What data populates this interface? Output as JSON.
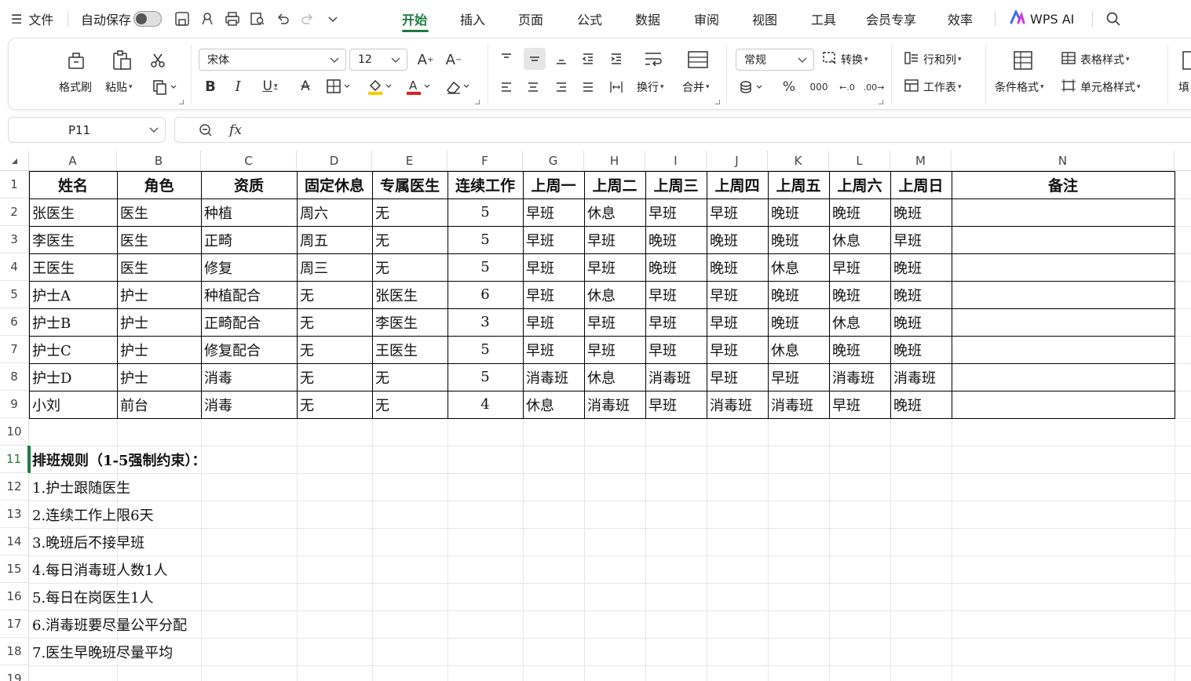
{
  "menubar": {
    "file_label": "文件",
    "autosave_label": "自动保存",
    "tabs": [
      "开始",
      "插入",
      "页面",
      "公式",
      "数据",
      "审阅",
      "视图",
      "工具",
      "会员专享",
      "效率"
    ],
    "wps_ai_label": "WPS AI",
    "colors": {
      "active_tab": "#1f7a41"
    }
  },
  "ribbon": {
    "format_painter": "格式刷",
    "paste": "粘贴",
    "font_name": "宋体",
    "font_size": "12",
    "wrap": "换行",
    "merge": "合并",
    "number_format": "常规",
    "convert": "转换",
    "row_col": "行和列",
    "worksheet": "工作表",
    "cond_format": "条件格式",
    "table_style": "表格样式",
    "cell_style": "单元格样式",
    "fill": "填",
    "font_color": "#e02020",
    "highlight_color": "#f5d000"
  },
  "formula_bar": {
    "cell_ref": "P11",
    "fx": "fx",
    "value": ""
  },
  "sheet": {
    "columns": [
      "A",
      "B",
      "C",
      "D",
      "E",
      "F",
      "G",
      "H",
      "I",
      "J",
      "K",
      "L",
      "M",
      "N"
    ],
    "rows": [
      "1",
      "2",
      "3",
      "4",
      "5",
      "6",
      "7",
      "8",
      "9",
      "10",
      "11",
      "12",
      "13",
      "14",
      "15",
      "16",
      "17",
      "18",
      "19"
    ],
    "table": {
      "headers": [
        "姓名",
        "角色",
        "资质",
        "固定休息",
        "专属医生",
        "连续工作",
        "上周一",
        "上周二",
        "上周三",
        "上周四",
        "上周五",
        "上周六",
        "上周日",
        "备注"
      ],
      "rows": [
        [
          "张医生",
          "医生",
          "种植",
          "周六",
          "无",
          "5",
          "早班",
          "休息",
          "早班",
          "早班",
          "晚班",
          "晚班",
          "晚班",
          ""
        ],
        [
          "李医生",
          "医生",
          "正畸",
          "周五",
          "无",
          "5",
          "早班",
          "早班",
          "晚班",
          "晚班",
          "晚班",
          "休息",
          "早班",
          ""
        ],
        [
          "王医生",
          "医生",
          "修复",
          "周三",
          "无",
          "5",
          "早班",
          "早班",
          "晚班",
          "晚班",
          "休息",
          "早班",
          "晚班",
          ""
        ],
        [
          "护士A",
          "护士",
          "种植配合",
          "无",
          "张医生",
          "6",
          "早班",
          "休息",
          "早班",
          "早班",
          "晚班",
          "晚班",
          "晚班",
          ""
        ],
        [
          "护士B",
          "护士",
          "正畸配合",
          "无",
          "李医生",
          "3",
          "早班",
          "早班",
          "早班",
          "早班",
          "晚班",
          "休息",
          "晚班",
          ""
        ],
        [
          "护士C",
          "护士",
          "修复配合",
          "无",
          "王医生",
          "5",
          "早班",
          "早班",
          "早班",
          "早班",
          "休息",
          "晚班",
          "晚班",
          ""
        ],
        [
          "护士D",
          "护士",
          "消毒",
          "无",
          "无",
          "5",
          "消毒班",
          "休息",
          "消毒班",
          "早班",
          "早班",
          "消毒班",
          "消毒班",
          ""
        ],
        [
          "小刘",
          "前台",
          "消毒",
          "无",
          "无",
          "4",
          "休息",
          "消毒班",
          "早班",
          "消毒班",
          "消毒班",
          "早班",
          "晚班",
          ""
        ]
      ]
    },
    "rules_title": "排班规则（1-5强制约束）：",
    "rules": [
      "1.护士跟随医生",
      "2.连续工作上限6天",
      "3.晚班后不接早班",
      "4.每日消毒班人数1人",
      "5.每日在岗医生1人",
      "6.消毒班要尽量公平分配",
      "7.医生早晚班尽量平均"
    ]
  }
}
